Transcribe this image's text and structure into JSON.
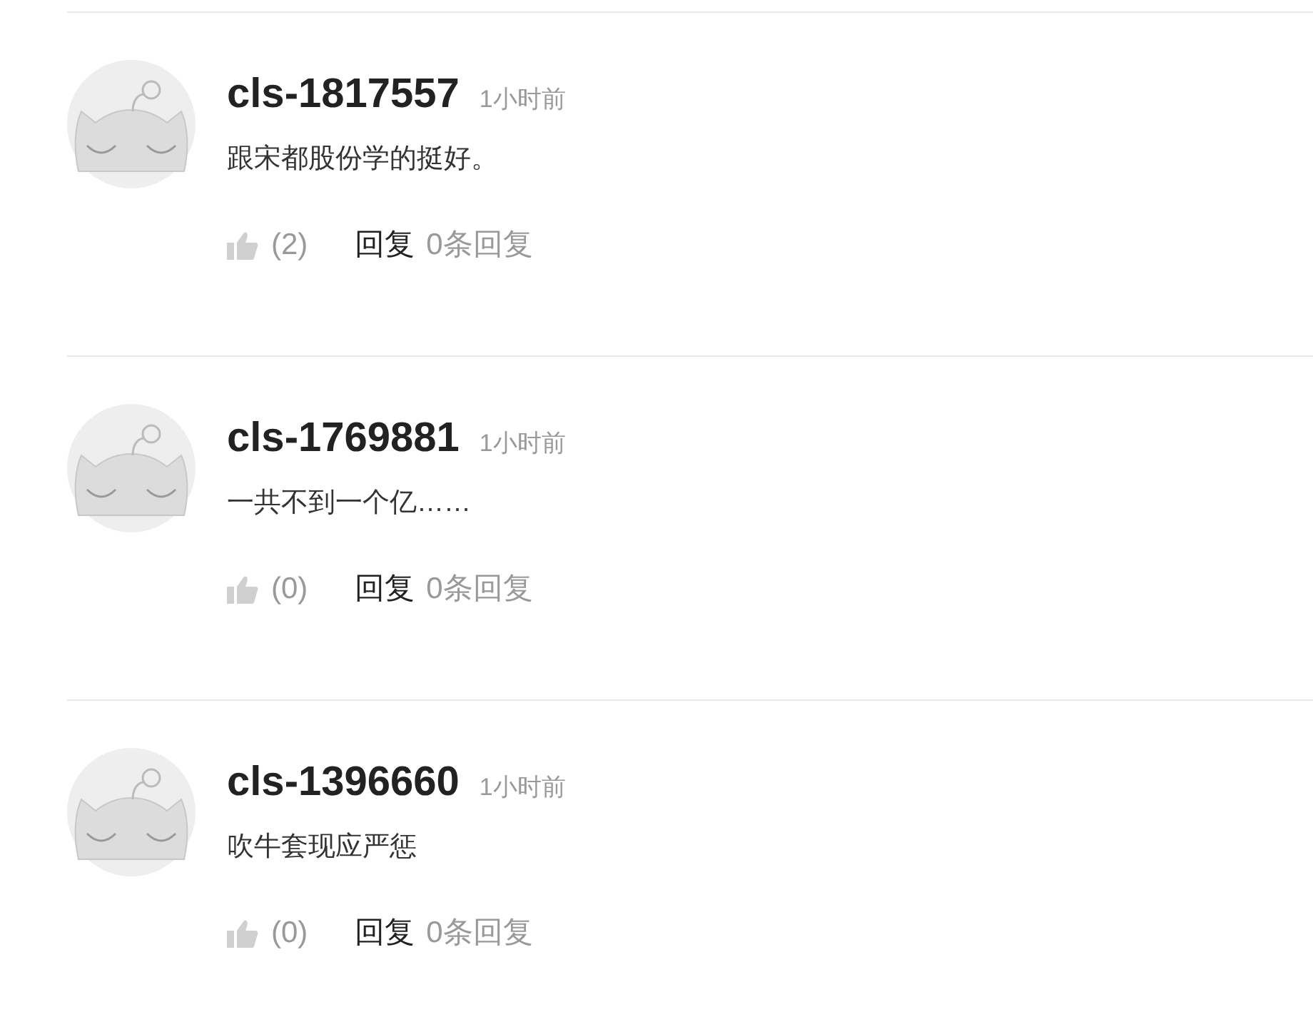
{
  "comments": [
    {
      "user": "cls-1817557",
      "time": "1小时前",
      "text": "跟宋都股份学的挺好。",
      "likes": "(2)",
      "reply": "回复",
      "reply_count": "0条回复"
    },
    {
      "user": "cls-1769881",
      "time": "1小时前",
      "text": "一共不到一个亿……",
      "likes": "(0)",
      "reply": "回复",
      "reply_count": "0条回复"
    },
    {
      "user": "cls-1396660",
      "time": "1小时前",
      "text": "吹牛套现应严惩",
      "likes": "(0)",
      "reply": "回复",
      "reply_count": "0条回复"
    }
  ]
}
